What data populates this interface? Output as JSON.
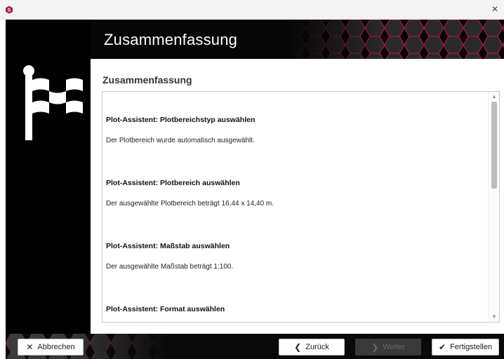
{
  "window": {
    "app_icon": "app-logo-icon",
    "close_icon": "close-icon"
  },
  "header": {
    "title": "Zusammenfassung"
  },
  "content": {
    "heading": "Zusammenfassung",
    "sections": [
      {
        "title": "Plot-Assistent: Plotbereichstyp auswählen",
        "text": "Der Plotbereich wurde automatisch ausgewählt."
      },
      {
        "title": "Plot-Assistent: Plotbereich auswählen",
        "text": "Der ausgewählte Plotbereich beträgt 16,44 x 14,40 m."
      },
      {
        "title": "Plot-Assistent: Maßstab auswählen",
        "text": "Der ausgewählte Maßstab beträgt 1:100."
      },
      {
        "title": "Plot-Assistent: Format auswählen",
        "text": ""
      }
    ]
  },
  "footer": {
    "cancel_label": "Abbrechen",
    "back_label": "Zurück",
    "next_label": "Weiter",
    "finish_label": "Fertigstellen",
    "next_enabled": false
  },
  "colors": {
    "accent": "#c2185b",
    "dark": "#000000"
  }
}
